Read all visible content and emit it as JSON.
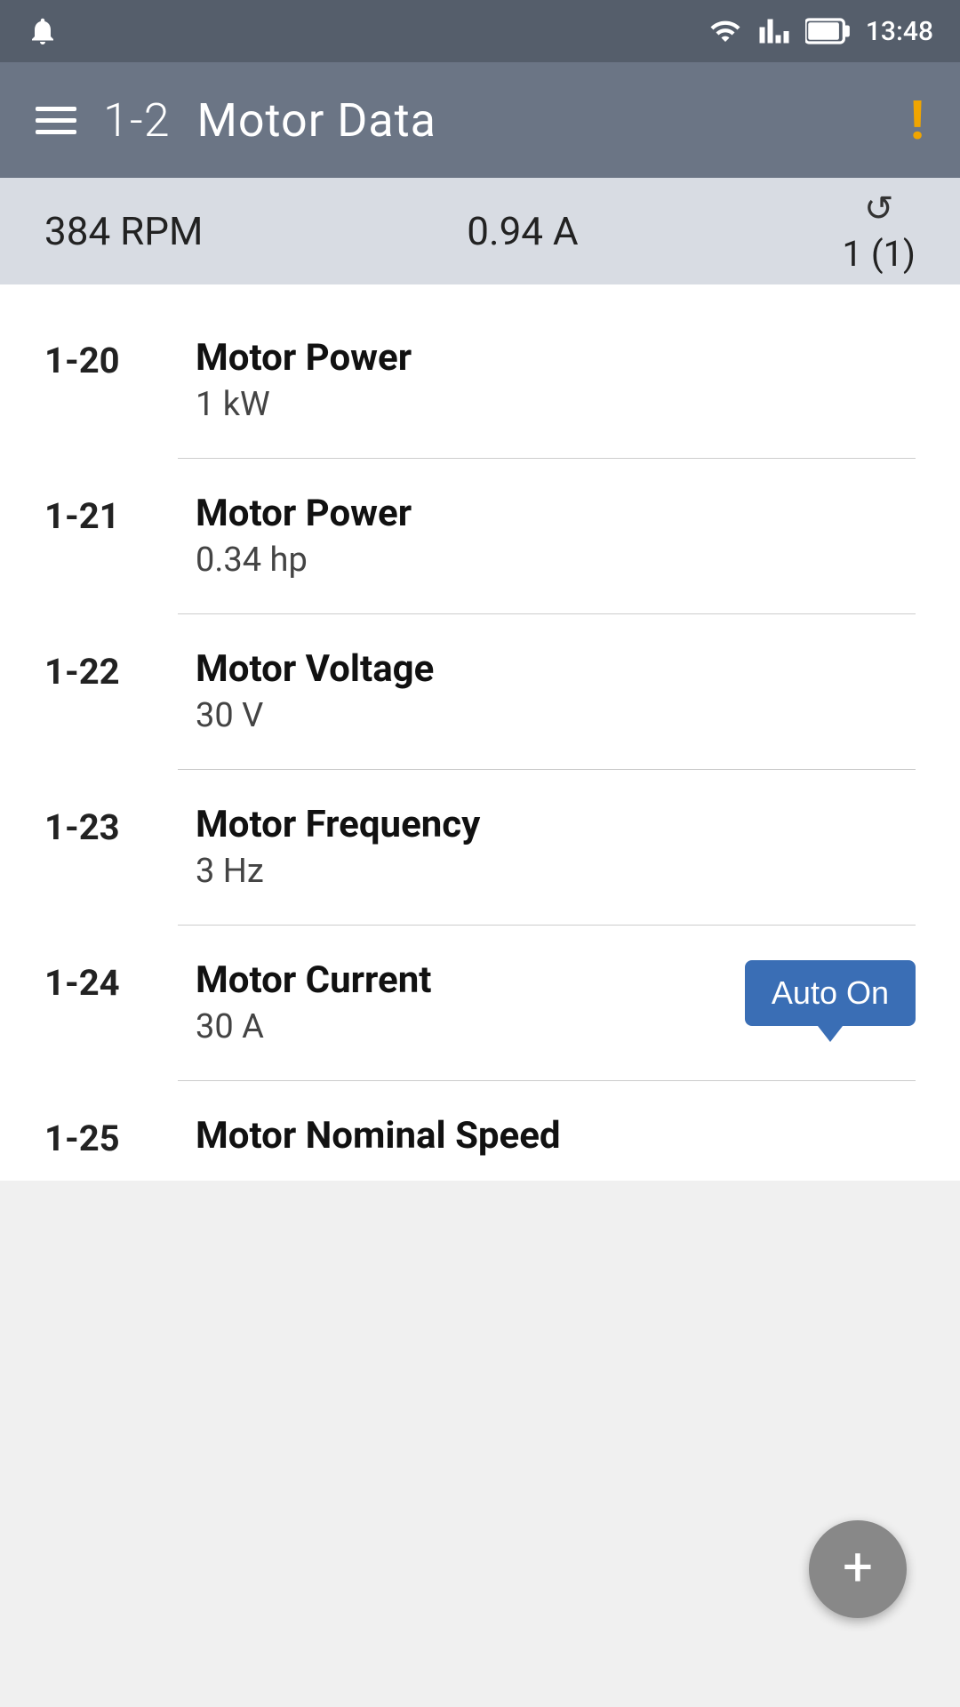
{
  "statusBar": {
    "time": "13:48"
  },
  "appBar": {
    "sectionNum": "1-2",
    "title": "Motor Data",
    "alertIcon": "!"
  },
  "summaryBar": {
    "rpm": "384 RPM",
    "amps": "0.94 A",
    "refreshIcon": "↺",
    "counter": "1 (1)"
  },
  "params": [
    {
      "id": "1-20",
      "name": "Motor Power",
      "value": "1 kW",
      "badge": null
    },
    {
      "id": "1-21",
      "name": "Motor Power",
      "value": "0.34 hp",
      "badge": null
    },
    {
      "id": "1-22",
      "name": "Motor Voltage",
      "value": "30 V",
      "badge": null
    },
    {
      "id": "1-23",
      "name": "Motor Frequency",
      "value": "3 Hz",
      "badge": null
    },
    {
      "id": "1-24",
      "name": "Motor Current",
      "value": "30 A",
      "badge": "Auto On"
    },
    {
      "id": "1-25",
      "name": "Motor Nominal Speed",
      "value": "",
      "badge": null
    }
  ],
  "fab": {
    "label": "+"
  }
}
